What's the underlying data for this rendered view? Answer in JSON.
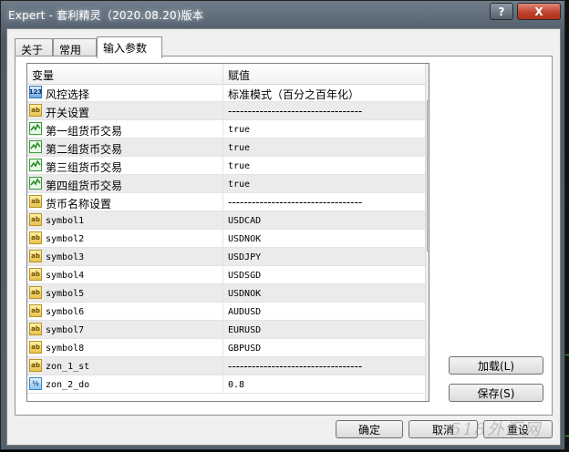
{
  "window": {
    "title": "Expert - 套利精灵（2020.08.20)版本",
    "help_label": "?",
    "close_label": "X"
  },
  "tabs": [
    {
      "label": "关于",
      "active": false
    },
    {
      "label": "常用",
      "active": false
    },
    {
      "label": "输入参数",
      "active": true
    }
  ],
  "grid": {
    "col_variable": "变量",
    "col_value": "赋值",
    "rows": [
      {
        "icon": "number-icon",
        "name": "风控选择",
        "value": "标准模式（百分之百年化）"
      },
      {
        "icon": "text-icon",
        "name": "开关设置",
        "value": "----------------------------------"
      },
      {
        "icon": "bool-icon",
        "name": "第一组货币交易",
        "value": "true"
      },
      {
        "icon": "bool-icon",
        "name": "第二组货币交易",
        "value": "true"
      },
      {
        "icon": "bool-icon",
        "name": "第三组货币交易",
        "value": "true"
      },
      {
        "icon": "bool-icon",
        "name": "第四组货币交易",
        "value": "true"
      },
      {
        "icon": "text-icon",
        "name": "货币名称设置",
        "value": "----------------------------------"
      },
      {
        "icon": "text-icon",
        "name": "symbol1",
        "value": "USDCAD"
      },
      {
        "icon": "text-icon",
        "name": "symbol2",
        "value": "USDNOK"
      },
      {
        "icon": "text-icon",
        "name": "symbol3",
        "value": "USDJPY"
      },
      {
        "icon": "text-icon",
        "name": "symbol4",
        "value": "USDSGD"
      },
      {
        "icon": "text-icon",
        "name": "symbol5",
        "value": "USDNOK"
      },
      {
        "icon": "text-icon",
        "name": "symbol6",
        "value": "AUDUSD"
      },
      {
        "icon": "text-icon",
        "name": "symbol7",
        "value": "EURUSD"
      },
      {
        "icon": "text-icon",
        "name": "symbol8",
        "value": "GBPUSD"
      },
      {
        "icon": "text-icon",
        "name": "zon_1_st",
        "value": "----------------------------------"
      },
      {
        "icon": "value-icon",
        "name": "zon_2_do",
        "value": "0.8"
      }
    ]
  },
  "buttons": {
    "load": "加载(L)",
    "save": "保存(S)",
    "ok": "确定",
    "cancel": "取消",
    "reset": "重设"
  },
  "watermark": "518外汇网"
}
